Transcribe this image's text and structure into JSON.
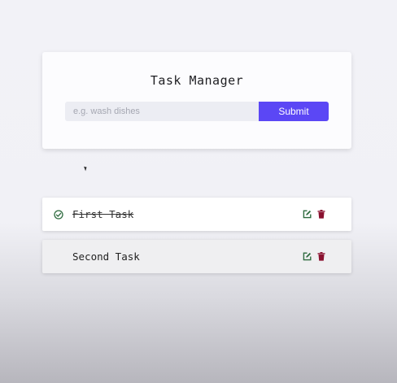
{
  "app": {
    "title": "Task Manager"
  },
  "form": {
    "placeholder": "e.g. wash dishes",
    "value": "",
    "submit_label": "Submit"
  },
  "tasks": [
    {
      "text": "First Task",
      "completed": true
    },
    {
      "text": "Second Task",
      "completed": false
    }
  ],
  "icons": {
    "check": "check-circle-icon",
    "edit": "edit-icon",
    "delete": "trash-icon"
  },
  "colors": {
    "accent": "#5b47f5",
    "edit": "#2e6b3f",
    "delete": "#8a1230",
    "check": "#2e6b3f"
  }
}
